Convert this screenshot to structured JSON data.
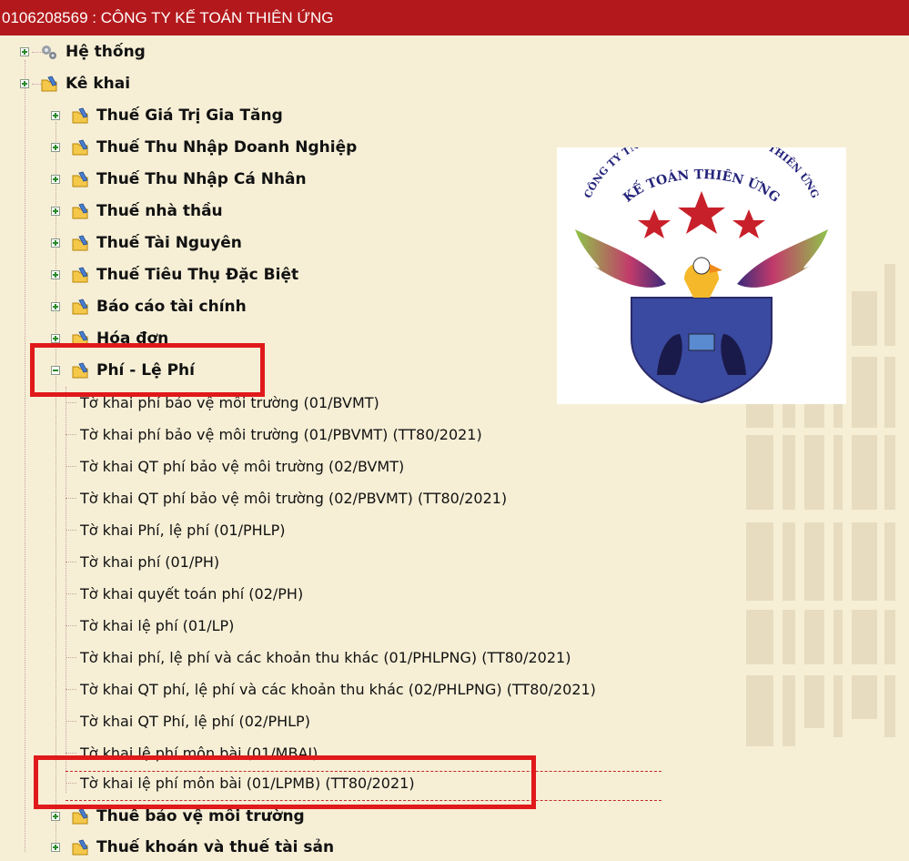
{
  "window": {
    "title": "0106208569 : CÔNG TY KẾ TOÁN THIÊN ỨNG"
  },
  "tree": {
    "root_items": [
      {
        "label": "Hệ thống",
        "icon": "gears-icon",
        "expanded": false
      },
      {
        "label": "Kê khai",
        "icon": "folder-edit-icon",
        "expanded": true
      }
    ],
    "kekhai_children": [
      "Thuế Giá Trị Gia Tăng",
      "Thuế Thu Nhập Doanh Nghiệp",
      "Thuế Thu Nhập Cá Nhân",
      "Thuế nhà thầu",
      "Thuế Tài Nguyên",
      "Thuế Tiêu Thụ Đặc Biệt",
      "Báo cáo tài chính",
      "Hóa đơn",
      "Phí - Lệ Phí"
    ],
    "phi_le_phi_leaves": [
      "Tờ khai phí bảo vệ môi trường (01/BVMT)",
      "Tờ khai phí bảo vệ môi trường (01/PBVMT) (TT80/2021)",
      "Tờ khai QT phí bảo vệ môi trường (02/BVMT)",
      "Tờ khai QT phí bảo vệ môi trường (02/PBVMT) (TT80/2021)",
      "Tờ khai Phí, lệ phí (01/PHLP)",
      "Tờ khai phí (01/PH)",
      "Tờ khai quyết toán phí (02/PH)",
      "Tờ khai lệ phí (01/LP)",
      "Tờ khai phí, lệ phí và các khoản thu khác (01/PHLPNG) (TT80/2021)",
      "Tờ khai QT phí, lệ phí và các khoản thu khác (02/PHLPNG) (TT80/2021)",
      "Tờ khai QT Phí, lệ phí (02/PHLP)",
      "Tờ khai lệ phí môn bài (01/MBAI)",
      "Tờ khai lệ phí môn bài (01/LPMB) (TT80/2021)"
    ],
    "after_items": [
      "Thuế bảo vệ môi trường",
      "Thuế khoán và thuế tài sản"
    ]
  },
  "logo": {
    "arc_text": "CÔNG TY TNHH DỊCH VỤ ĐÀO TẠO THIÊN ỨNG",
    "name_text": "KẾ TOÁN THIÊN ỨNG"
  },
  "colors": {
    "titlebar": "#b3191c",
    "background": "#f6efd6",
    "highlight": "#e0191b"
  }
}
